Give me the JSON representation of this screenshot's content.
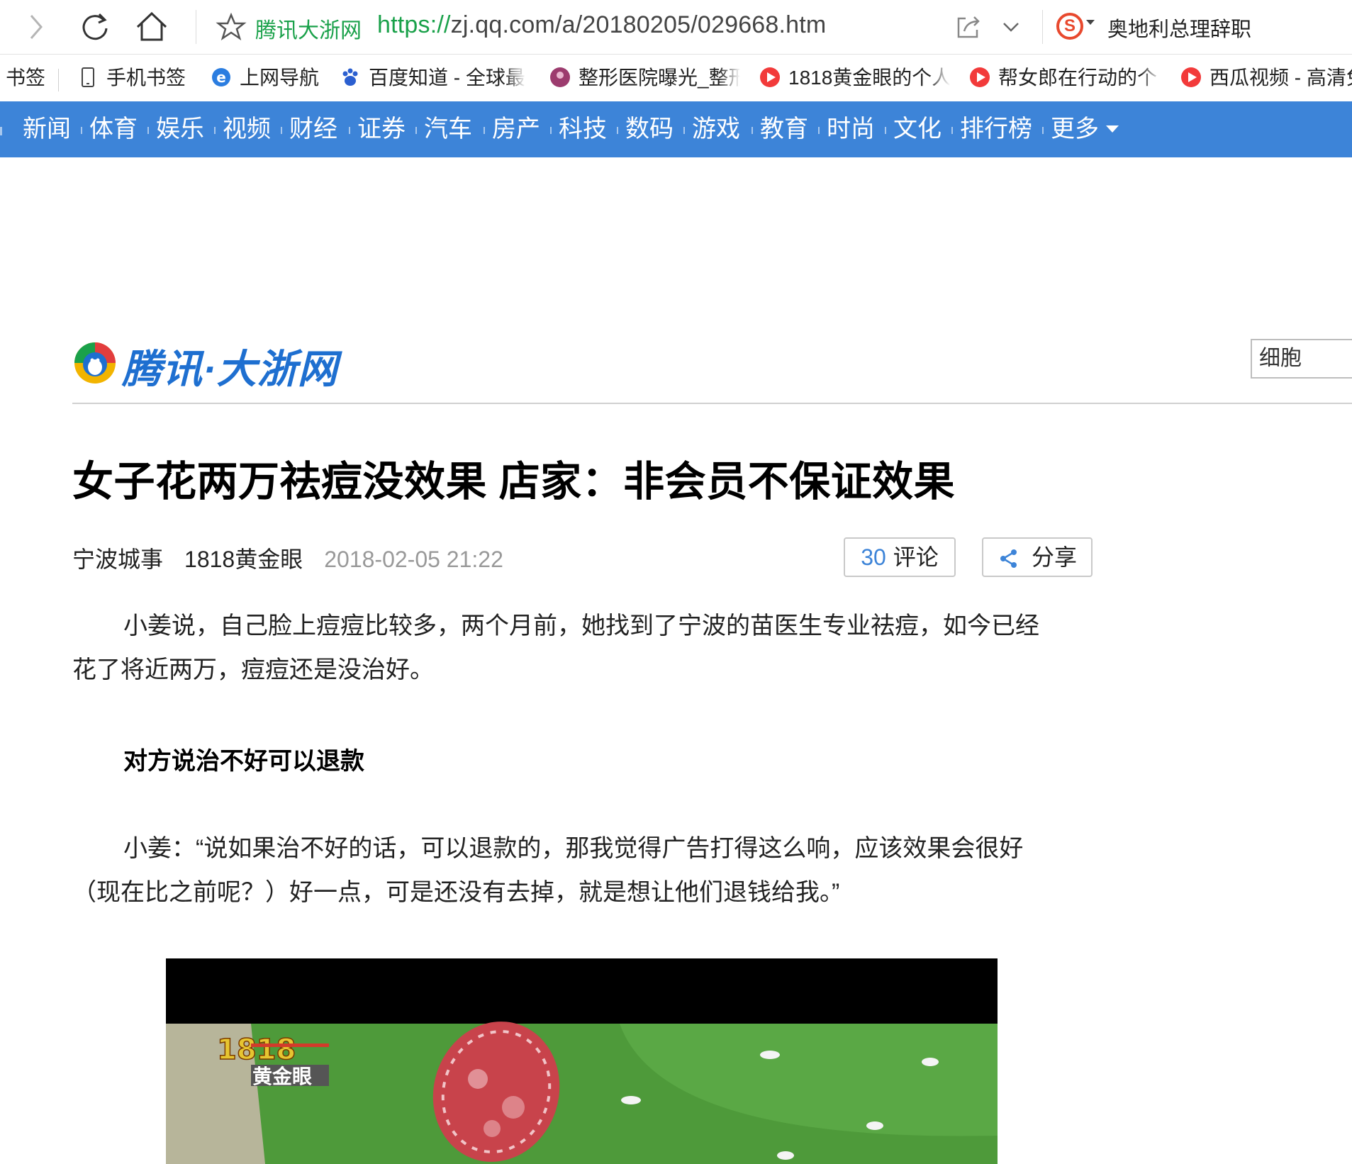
{
  "browser": {
    "address_site_label": "腾讯大浙网",
    "address_scheme": "https://",
    "address_rest": "zj.qq.com/a/20180205/029668.htm",
    "search_engine_letter": "S",
    "search_hot_text": "奥地利总理辞职"
  },
  "bookmarks": [
    {
      "label": "书签",
      "icon": "none"
    },
    {
      "label": "手机书签",
      "icon": "phone-icon"
    },
    {
      "label": "上网导航",
      "icon": "ie-icon"
    },
    {
      "label": "百度知道 - 全球最",
      "icon": "baidu-paw-icon"
    },
    {
      "label": "整形医院曝光_整形",
      "icon": "clinic-logo-icon"
    },
    {
      "label": "1818黄金眼的个人",
      "icon": "play-icon"
    },
    {
      "label": "帮女郎在行动的个",
      "icon": "play-icon"
    },
    {
      "label": "西瓜视频 - 高清免",
      "icon": "play-icon"
    }
  ],
  "nav": {
    "items": [
      "新闻",
      "体育",
      "娱乐",
      "视频",
      "财经",
      "证券",
      "汽车",
      "房产",
      "科技",
      "数码",
      "游戏",
      "教育",
      "时尚",
      "文化",
      "排行榜",
      "更多"
    ]
  },
  "header": {
    "logo_text": "腾讯·大浙网",
    "search_value": "细胞"
  },
  "article": {
    "title": "女子花两万祛痘没效果 店家：非会员不保证效果",
    "source": "宁波城事",
    "author": "1818黄金眼",
    "date": "2018-02-05 21:22",
    "comment_count": "30",
    "comment_label": "评论",
    "share_label": "分享",
    "para1_line1": "小姜说，自己脸上痘痘比较多，两个月前，她找到了宁波的苗医生专业祛痘，如今已经",
    "para1_line2": "花了将近两万，痘痘还是没治好。",
    "subheading": "对方说治不好可以退款",
    "para2_line1": "小姜：“说如果治不好的话，可以退款的，那我觉得广告打得这么响，应该效果会很好",
    "para2_line2": "（现在比之前呢？）好一点，可是还没有去掉，就是想让他们退钱给我。”"
  },
  "video": {
    "watermark_top": "1818",
    "watermark_bottom": "黄金眼",
    "colors": {
      "field": "#4e9a3a",
      "field_dark": "#3f8630",
      "disc": "#c8434b",
      "letterbox": "#000000"
    }
  },
  "colors": {
    "nav_bg": "#3d84d8",
    "link_green": "#1aa14a",
    "logo_blue": "#1e6fd0",
    "accent_blue": "#3d84d8",
    "date_gray": "#999999"
  }
}
